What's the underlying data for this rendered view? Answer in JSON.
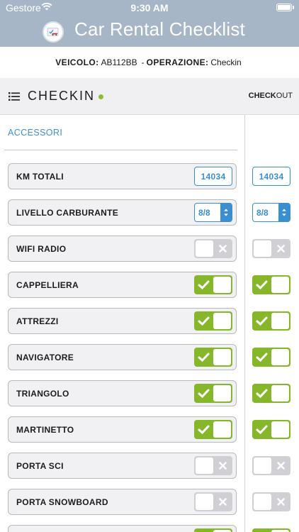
{
  "status_bar": {
    "carrier": "Gestore",
    "time": "9:30 AM"
  },
  "header": {
    "title": "Car Rental Checklist",
    "logo": "car-logo-icon"
  },
  "vehicle": {
    "veicolo_label": "VEICOLO:",
    "veicolo_value": "AB112BB",
    "separator": "-",
    "operazione_label": "OPERAZIONE:",
    "operazione_value": "Checkin"
  },
  "section": {
    "title": "CHECKIN",
    "checkout_bold": "CHECK",
    "checkout_rest": "OUT",
    "menu_icon": "list-icon"
  },
  "group": {
    "title": "ACCESSORI"
  },
  "colors": {
    "accent_blue": "#3a8fd0",
    "toggle_on": "#86b629",
    "toggle_off": "#d0d0d4",
    "header_bg": "#a6b6c6"
  },
  "rows": [
    {
      "label": "KM TOTALI",
      "type": "number",
      "checkin": "14034",
      "checkout": "14034"
    },
    {
      "label": "LIVELLO CARBURANTE",
      "type": "select",
      "checkin": "8/8",
      "checkout": "8/8"
    },
    {
      "label": "WIFI RADIO",
      "type": "toggle",
      "checkin": false,
      "checkout": false
    },
    {
      "label": "CAPPELLIERA",
      "type": "toggle",
      "checkin": true,
      "checkout": true
    },
    {
      "label": "ATTREZZI",
      "type": "toggle",
      "checkin": true,
      "checkout": true
    },
    {
      "label": "NAVIGATORE",
      "type": "toggle",
      "checkin": true,
      "checkout": true
    },
    {
      "label": "TRIANGOLO",
      "type": "toggle",
      "checkin": true,
      "checkout": true
    },
    {
      "label": "MARTINETTO",
      "type": "toggle",
      "checkin": true,
      "checkout": true
    },
    {
      "label": "PORTA SCI",
      "type": "toggle",
      "checkin": false,
      "checkout": false
    },
    {
      "label": "PORTA SNOWBOARD",
      "type": "toggle",
      "checkin": false,
      "checkout": false
    },
    {
      "label": "",
      "type": "toggle",
      "checkin": true,
      "checkout": true
    }
  ]
}
